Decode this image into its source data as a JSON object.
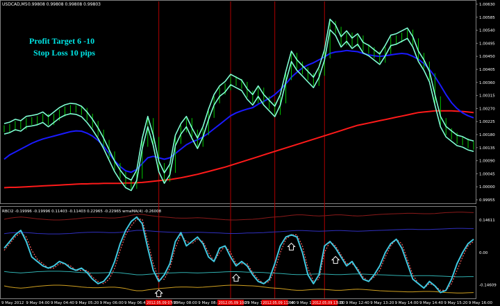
{
  "header": {
    "symbol": "USDCAD,M5",
    "ohlc": "0.99808 0.99808 0.99808 0.99803"
  },
  "annotations": {
    "profit_target": "Profit Target 6 -10",
    "stop_loss": "Stop Loss 10 pips"
  },
  "indicator": {
    "label": "RBCI2 -0.19996 -0.19996 0.11403 -0.11403 0.22965 -0.22965 wmaMA(4) -0.26008",
    "right_labels": [
      "0.14611",
      "0.00",
      "-0.14609"
    ]
  },
  "price_axis": [
    "1.00630",
    "1.00585",
    "1.00540",
    "1.00495",
    "1.00450",
    "1.00405",
    "1.00360",
    "1.00315",
    "1.00270",
    "1.00225",
    "1.00180",
    "1.00135",
    "1.00090",
    "1.00045",
    "1.00000",
    "0.99955"
  ],
  "time_axis": [
    "9 May 2012",
    "9 May 04:00",
    "9 May 04:40",
    "9 May 05:20",
    "9 May 06:00",
    "9 May 06:40",
    "9 May 07:20",
    "9 May 08:00",
    "9 May 08:40",
    "9 May 09:20",
    "9 May 10:00",
    "9 May 10:40",
    "9 May 11:20",
    "9 May 12:00",
    "9 May 12:40",
    "9 May 13:20",
    "9 May 14:00",
    "9 May 14:40",
    "9 May 15:20",
    "9 May 16:00"
  ],
  "highlighted_times": [
    "2012.05.09 07:15",
    "2012.05.09 10:25",
    "2012.05.09 11:50",
    "2012.05.09 13:35"
  ],
  "chart_data": {
    "type": "line",
    "price_ylim": [
      0.99955,
      1.0063
    ],
    "price_close": [
      1.002,
      1.00205,
      1.00215,
      1.0021,
      1.00225,
      1.00228,
      1.00232,
      1.0024,
      1.00225,
      1.0024,
      1.00255,
      1.00265,
      1.0027,
      1.00268,
      1.0026,
      1.0024,
      1.00215,
      1.00185,
      1.0015,
      1.0011,
      1.0007,
      1.0004,
      1.00015,
      1.00005,
      1.0004,
      1.0015,
      1.00225,
      1.0016,
      1.0007,
      1.0003,
      1.0006,
      1.0016,
      1.002,
      1.00225,
      1.00185,
      1.0015,
      1.0019,
      1.0025,
      1.003,
      1.0033,
      1.00345,
      1.0037,
      1.0036,
      1.0035,
      1.0032,
      1.003,
      1.0033,
      1.003,
      1.0028,
      1.0026,
      1.003,
      1.0038,
      1.0045,
      1.0042,
      1.004,
      1.0038,
      1.0036,
      1.00395,
      1.00455,
      1.0056,
      1.0054,
      1.005,
      1.0052,
      1.00495,
      1.0051,
      1.0048,
      1.0047,
      1.00455,
      1.0044,
      1.0047,
      1.00505,
      1.0051,
      1.0052,
      1.0053,
      1.005,
      1.0045,
      1.0042,
      1.0038,
      1.003,
      1.00225,
      1.0019,
      1.00175,
      1.0016,
      1.00155,
      1.00145,
      1.0014
    ],
    "ema_blue": [
      1.00095,
      1.0011,
      1.0012,
      1.0013,
      1.0014,
      1.0015,
      1.00158,
      1.00165,
      1.0017,
      1.00175,
      1.0018,
      1.00185,
      1.0019,
      1.00193,
      1.00192,
      1.00185,
      1.00175,
      1.0016,
      1.0014,
      1.00115,
      1.0009,
      1.0007,
      1.00055,
      1.0005,
      1.0006,
      1.0008,
      1.001,
      1.00105,
      1.001,
      1.00095,
      1.001,
      1.00115,
      1.0013,
      1.00145,
      1.00155,
      1.00162,
      1.00172,
      1.00185,
      1.002,
      1.00215,
      1.0023,
      1.00245,
      1.00255,
      1.00262,
      1.00268,
      1.00273,
      1.00285,
      1.00295,
      1.00305,
      1.00318,
      1.00335,
      1.00355,
      1.00378,
      1.00395,
      1.0041,
      1.0042,
      1.00428,
      1.00438,
      1.00448,
      1.0046,
      1.00465,
      1.00467,
      1.0047,
      1.00468,
      1.00466,
      1.0046,
      1.00455,
      1.00452,
      1.0045,
      1.00452,
      1.00455,
      1.00458,
      1.0046,
      1.00458,
      1.0045,
      1.0044,
      1.00425,
      1.00405,
      1.0038,
      1.0035,
      1.00318,
      1.0029,
      1.0027,
      1.00255,
      1.00245,
      1.00238
    ],
    "sma_red": [
      0.99997,
      0.99998,
      0.99998,
      0.99999,
      1.0,
      1.00001,
      1.00002,
      1.00003,
      1.00004,
      1.00005,
      1.00006,
      1.00007,
      1.00008,
      1.00009,
      1.0001,
      1.0001,
      1.00011,
      1.00011,
      1.00012,
      1.00012,
      1.00012,
      1.00012,
      1.00013,
      1.00013,
      1.00014,
      1.00015,
      1.00017,
      1.00019,
      1.00021,
      1.00023,
      1.00025,
      1.00028,
      1.00031,
      1.00035,
      1.00039,
      1.00043,
      1.00048,
      1.00053,
      1.00058,
      1.00063,
      1.00068,
      1.00074,
      1.0008,
      1.00086,
      1.00092,
      1.00098,
      1.00104,
      1.0011,
      1.00116,
      1.00122,
      1.00128,
      1.00134,
      1.0014,
      1.00146,
      1.00152,
      1.00158,
      1.00164,
      1.0017,
      1.00176,
      1.00182,
      1.00188,
      1.00194,
      1.002,
      1.00206,
      1.00212,
      1.00216,
      1.0022,
      1.00224,
      1.00228,
      1.00232,
      1.00236,
      1.0024,
      1.00244,
      1.00248,
      1.00252,
      1.00256,
      1.00258,
      1.0026,
      1.00262,
      1.00262,
      1.00262,
      1.00262,
      1.00261,
      1.0026,
      1.00258,
      1.00256
    ],
    "osc_ylim": [
      -0.2,
      0.2
    ],
    "osc_main": [
      0.02,
      0.05,
      0.08,
      0.1,
      0.05,
      -0.02,
      -0.04,
      -0.06,
      -0.07,
      -0.06,
      -0.04,
      -0.05,
      -0.07,
      -0.08,
      -0.07,
      -0.09,
      -0.12,
      -0.14,
      -0.13,
      -0.1,
      -0.04,
      0.04,
      0.1,
      0.14,
      0.16,
      0.13,
      0.02,
      -0.08,
      -0.13,
      -0.1,
      -0.05,
      0.05,
      0.09,
      0.03,
      0.05,
      0.07,
      0.04,
      -0.02,
      -0.04,
      0.02,
      0.03,
      -0.02,
      -0.06,
      -0.04,
      -0.06,
      -0.1,
      -0.13,
      -0.14,
      -0.12,
      -0.05,
      0.03,
      0.07,
      0.08,
      0.07,
      0.0,
      -0.1,
      -0.14,
      -0.1,
      0.03,
      0.05,
      0.02,
      -0.02,
      -0.06,
      -0.04,
      -0.08,
      -0.12,
      -0.13,
      -0.1,
      -0.06,
      0.0,
      0.04,
      0.06,
      0.02,
      -0.05,
      -0.12,
      -0.14,
      -0.16,
      -0.13,
      -0.15,
      -0.18,
      -0.17,
      -0.12,
      -0.05,
      0.0,
      0.04,
      0.06
    ],
    "osc_signal": [
      0.01,
      0.04,
      0.07,
      0.09,
      0.07,
      0.01,
      -0.03,
      -0.05,
      -0.07,
      -0.07,
      -0.05,
      -0.05,
      -0.06,
      -0.08,
      -0.08,
      -0.08,
      -0.11,
      -0.13,
      -0.14,
      -0.12,
      -0.07,
      0.01,
      0.08,
      0.12,
      0.15,
      0.15,
      0.05,
      -0.05,
      -0.12,
      -0.12,
      -0.07,
      0.02,
      0.08,
      0.05,
      0.04,
      0.06,
      0.05,
      0.0,
      -0.04,
      0.0,
      0.03,
      0.0,
      -0.05,
      -0.05,
      -0.05,
      -0.09,
      -0.12,
      -0.14,
      -0.13,
      -0.08,
      0.0,
      0.06,
      0.08,
      0.08,
      0.03,
      -0.07,
      -0.13,
      -0.12,
      0.0,
      0.05,
      0.03,
      -0.01,
      -0.05,
      -0.05,
      -0.07,
      -0.11,
      -0.13,
      -0.11,
      -0.08,
      -0.02,
      0.03,
      0.06,
      0.04,
      -0.03,
      -0.1,
      -0.14,
      -0.16,
      -0.14,
      -0.15,
      -0.17,
      -0.17,
      -0.14,
      -0.08,
      -0.02,
      0.03,
      0.05
    ],
    "band_upper_dark": [
      0.15,
      0.155,
      0.158,
      0.16,
      0.158,
      0.155,
      0.152,
      0.15,
      0.148,
      0.147,
      0.147,
      0.148,
      0.15,
      0.152,
      0.155,
      0.157,
      0.158,
      0.158,
      0.157,
      0.156,
      0.156,
      0.158,
      0.162,
      0.168,
      0.172,
      0.172,
      0.168,
      0.165,
      0.162,
      0.16,
      0.158,
      0.156,
      0.155,
      0.155,
      0.156,
      0.157,
      0.156,
      0.154,
      0.152,
      0.15,
      0.148,
      0.147,
      0.147,
      0.148,
      0.149,
      0.15,
      0.152,
      0.155,
      0.158,
      0.16,
      0.162,
      0.165,
      0.168,
      0.17,
      0.17,
      0.168,
      0.166,
      0.165,
      0.166,
      0.168,
      0.17,
      0.17,
      0.168,
      0.166,
      0.165,
      0.166,
      0.168,
      0.17,
      0.172,
      0.173,
      0.174,
      0.175,
      0.176,
      0.177,
      0.177,
      0.176,
      0.175,
      0.175,
      0.176,
      0.178,
      0.18,
      0.181,
      0.182,
      0.182,
      0.181,
      0.18
    ],
    "band_upper_blue": [
      0.085,
      0.088,
      0.09,
      0.092,
      0.09,
      0.088,
      0.086,
      0.085,
      0.084,
      0.084,
      0.084,
      0.085,
      0.086,
      0.088,
      0.09,
      0.091,
      0.092,
      0.092,
      0.091,
      0.09,
      0.09,
      0.091,
      0.094,
      0.097,
      0.1,
      0.1,
      0.098,
      0.096,
      0.094,
      0.093,
      0.092,
      0.091,
      0.09,
      0.09,
      0.091,
      0.092,
      0.091,
      0.09,
      0.089,
      0.088,
      0.087,
      0.086,
      0.086,
      0.087,
      0.088,
      0.088,
      0.089,
      0.09,
      0.092,
      0.093,
      0.094,
      0.096,
      0.098,
      0.099,
      0.099,
      0.098,
      0.097,
      0.096,
      0.097,
      0.098,
      0.099,
      0.099,
      0.098,
      0.097,
      0.096,
      0.097,
      0.098,
      0.099,
      0.1,
      0.101,
      0.102,
      0.103,
      0.104,
      0.105,
      0.105,
      0.104,
      0.104,
      0.104,
      0.105,
      0.106,
      0.107,
      0.108,
      0.109,
      0.109,
      0.108,
      0.108
    ],
    "band_lower_cyan": [
      -0.085,
      -0.088,
      -0.09,
      -0.092,
      -0.09,
      -0.088,
      -0.086,
      -0.085,
      -0.084,
      -0.084,
      -0.084,
      -0.085,
      -0.086,
      -0.088,
      -0.09,
      -0.091,
      -0.092,
      -0.092,
      -0.091,
      -0.09,
      -0.09,
      -0.091,
      -0.094,
      -0.097,
      -0.1,
      -0.1,
      -0.098,
      -0.096,
      -0.094,
      -0.093,
      -0.092,
      -0.091,
      -0.09,
      -0.09,
      -0.091,
      -0.092,
      -0.091,
      -0.09,
      -0.089,
      -0.088,
      -0.087,
      -0.086,
      -0.086,
      -0.087,
      -0.088,
      -0.088,
      -0.089,
      -0.09,
      -0.092,
      -0.093,
      -0.094,
      -0.096,
      -0.098,
      -0.099,
      -0.099,
      -0.098,
      -0.097,
      -0.096,
      -0.097,
      -0.098,
      -0.099,
      -0.099,
      -0.098,
      -0.097,
      -0.096,
      -0.097,
      -0.098,
      -0.099,
      -0.1,
      -0.101,
      -0.102,
      -0.103,
      -0.104,
      -0.105,
      -0.105,
      -0.104,
      -0.104,
      -0.104,
      -0.105,
      -0.106,
      -0.107,
      -0.108,
      -0.109,
      -0.109,
      -0.108,
      -0.108
    ],
    "band_lower_orange": [
      -0.15,
      -0.155,
      -0.158,
      -0.16,
      -0.158,
      -0.155,
      -0.152,
      -0.15,
      -0.148,
      -0.147,
      -0.147,
      -0.148,
      -0.15,
      -0.152,
      -0.155,
      -0.157,
      -0.158,
      -0.158,
      -0.157,
      -0.156,
      -0.156,
      -0.158,
      -0.162,
      -0.168,
      -0.172,
      -0.172,
      -0.168,
      -0.165,
      -0.162,
      -0.16,
      -0.158,
      -0.156,
      -0.155,
      -0.155,
      -0.156,
      -0.157,
      -0.156,
      -0.154,
      -0.152,
      -0.15,
      -0.148,
      -0.147,
      -0.147,
      -0.148,
      -0.149,
      -0.15,
      -0.152,
      -0.155,
      -0.158,
      -0.16,
      -0.162,
      -0.165,
      -0.168,
      -0.17,
      -0.17,
      -0.168,
      -0.166,
      -0.165,
      -0.166,
      -0.168,
      -0.17,
      -0.17,
      -0.168,
      -0.166,
      -0.165,
      -0.166,
      -0.168,
      -0.17,
      -0.172,
      -0.173,
      -0.174,
      -0.175,
      -0.176,
      -0.177,
      -0.177,
      -0.176,
      -0.175,
      -0.175,
      -0.176,
      -0.178,
      -0.18,
      -0.181,
      -0.182,
      -0.182,
      -0.181,
      -0.18
    ],
    "signal_bars": [
      28,
      41,
      49,
      58
    ],
    "signal_arrow_bars": [
      28,
      42,
      52,
      60
    ]
  },
  "colors": {
    "background": "#000000",
    "candles": "#00cc00",
    "envelope": "#7fffd4",
    "ema": "#1a1aff",
    "sma": "#ff1a1a",
    "osc_main": "#40c8e0",
    "osc_signal": "#ff6060",
    "band_dark": "#8b1a1a",
    "band_blue": "#3030c0",
    "band_cyan": "#30b0b0",
    "band_orange": "#d0a020",
    "text": "#ffffff",
    "annotation": "#00e5e5",
    "highlight": "#e00000"
  }
}
